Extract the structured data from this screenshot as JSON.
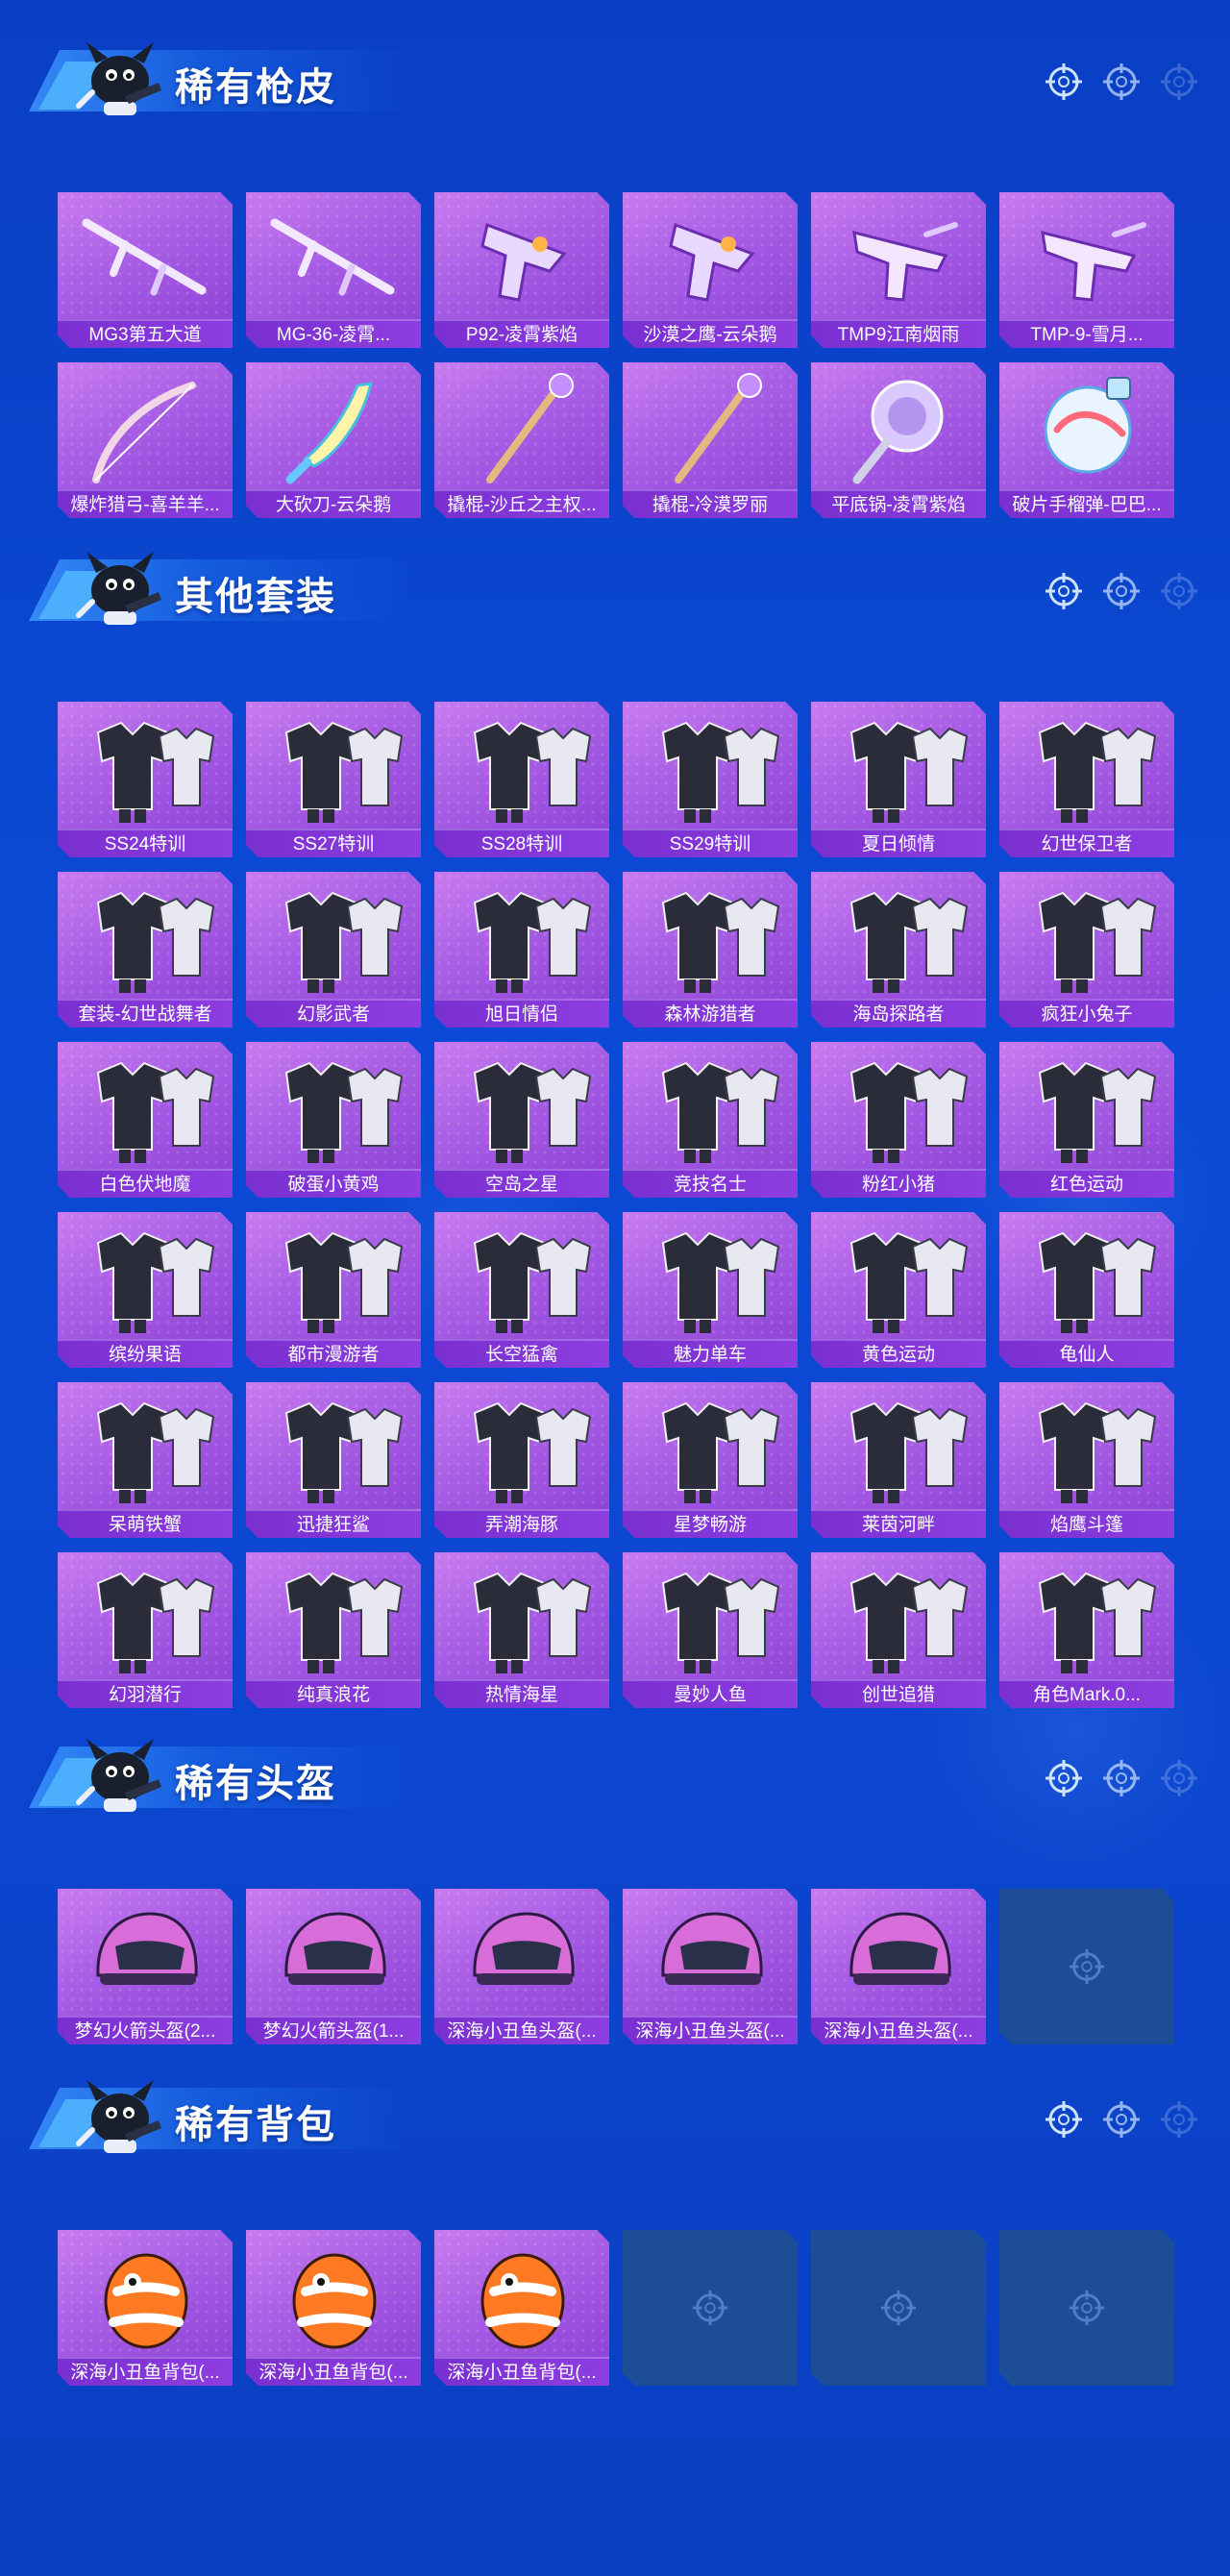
{
  "colors": {
    "background": "#0b45cf",
    "card_purple": "#a65ce4",
    "label_purple": "#7a2fd0",
    "empty_slot": "#1c4d96",
    "text": "#ffffff"
  },
  "sections": [
    {
      "title": "稀有枪皮",
      "items": [
        {
          "name": "MG3第五大道",
          "icon": "machine-gun-skin-icon"
        },
        {
          "name": "MG-36-凌霄...",
          "icon": "machine-gun-skin-icon"
        },
        {
          "name": "P92-凌霄紫焰",
          "icon": "pistol-skin-icon"
        },
        {
          "name": "沙漠之鹰-云朵鹅",
          "icon": "pistol-skin-icon"
        },
        {
          "name": "TMP9江南烟雨",
          "icon": "smg-skin-icon"
        },
        {
          "name": "TMP-9-雪月...",
          "icon": "smg-skin-icon"
        },
        {
          "name": "爆炸猎弓-喜羊羊...",
          "icon": "bow-skin-icon"
        },
        {
          "name": "大砍刀-云朵鹅",
          "icon": "machete-skin-icon"
        },
        {
          "name": "撬棍-沙丘之主权...",
          "icon": "crowbar-skin-icon"
        },
        {
          "name": "撬棍-冷漠罗丽",
          "icon": "crowbar-skin-icon"
        },
        {
          "name": "平底锅-凌霄紫焰",
          "icon": "pan-skin-icon"
        },
        {
          "name": "破片手榴弹-巴巴...",
          "icon": "grenade-skin-icon"
        }
      ]
    },
    {
      "title": "其他套装",
      "items": [
        {
          "name": "SS24特训",
          "icon": "outfit-set-icon"
        },
        {
          "name": "SS27特训",
          "icon": "outfit-set-icon"
        },
        {
          "name": "SS28特训",
          "icon": "outfit-set-icon"
        },
        {
          "name": "SS29特训",
          "icon": "outfit-set-icon"
        },
        {
          "name": "夏日倾情",
          "icon": "outfit-set-icon"
        },
        {
          "name": "幻世保卫者",
          "icon": "outfit-set-icon"
        },
        {
          "name": "套装-幻世战舞者",
          "icon": "outfit-set-icon"
        },
        {
          "name": "幻影武者",
          "icon": "outfit-set-icon"
        },
        {
          "name": "旭日情侣",
          "icon": "outfit-set-icon"
        },
        {
          "name": "森林游猎者",
          "icon": "outfit-set-icon"
        },
        {
          "name": "海岛探路者",
          "icon": "outfit-set-icon"
        },
        {
          "name": "疯狂小兔子",
          "icon": "outfit-set-icon"
        },
        {
          "name": "白色伏地魔",
          "icon": "outfit-set-icon"
        },
        {
          "name": "破蛋小黄鸡",
          "icon": "outfit-set-icon"
        },
        {
          "name": "空岛之星",
          "icon": "outfit-set-icon"
        },
        {
          "name": "竞技名士",
          "icon": "outfit-set-icon"
        },
        {
          "name": "粉红小猪",
          "icon": "outfit-set-icon"
        },
        {
          "name": "红色运动",
          "icon": "outfit-set-icon"
        },
        {
          "name": "缤纷果语",
          "icon": "outfit-set-icon"
        },
        {
          "name": "都市漫游者",
          "icon": "outfit-set-icon"
        },
        {
          "name": "长空猛禽",
          "icon": "outfit-set-icon"
        },
        {
          "name": "魅力单车",
          "icon": "outfit-set-icon"
        },
        {
          "name": "黄色运动",
          "icon": "outfit-set-icon"
        },
        {
          "name": "龟仙人",
          "icon": "outfit-set-icon"
        },
        {
          "name": "呆萌铁蟹",
          "icon": "outfit-set-icon"
        },
        {
          "name": "迅捷狂鲨",
          "icon": "outfit-set-icon"
        },
        {
          "name": "弄潮海豚",
          "icon": "outfit-set-icon"
        },
        {
          "name": "星梦畅游",
          "icon": "outfit-set-icon"
        },
        {
          "name": "莱茵河畔",
          "icon": "outfit-set-icon"
        },
        {
          "name": "焰鹰斗篷",
          "icon": "outfit-set-icon"
        },
        {
          "name": "幻羽潜行",
          "icon": "outfit-set-icon"
        },
        {
          "name": "纯真浪花",
          "icon": "outfit-set-icon"
        },
        {
          "name": "热情海星",
          "icon": "outfit-set-icon"
        },
        {
          "name": "曼妙人鱼",
          "icon": "outfit-set-icon"
        },
        {
          "name": "创世追猎",
          "icon": "outfit-set-icon"
        },
        {
          "name": "角色Mark.0...",
          "icon": "outfit-set-icon"
        }
      ]
    },
    {
      "title": "稀有头盔",
      "items": [
        {
          "name": "梦幻火箭头盔(2...",
          "icon": "helmet-skin-icon"
        },
        {
          "name": "梦幻火箭头盔(1...",
          "icon": "helmet-skin-icon"
        },
        {
          "name": "深海小丑鱼头盔(...",
          "icon": "helmet-skin-icon"
        },
        {
          "name": "深海小丑鱼头盔(...",
          "icon": "helmet-skin-icon"
        },
        {
          "name": "深海小丑鱼头盔(...",
          "icon": "helmet-skin-icon"
        }
      ],
      "empty_slots": 1
    },
    {
      "title": "稀有背包",
      "items": [
        {
          "name": "深海小丑鱼背包(...",
          "icon": "backpack-skin-icon"
        },
        {
          "name": "深海小丑鱼背包(...",
          "icon": "backpack-skin-icon"
        },
        {
          "name": "深海小丑鱼背包(...",
          "icon": "backpack-skin-icon"
        }
      ],
      "empty_slots": 3
    }
  ]
}
